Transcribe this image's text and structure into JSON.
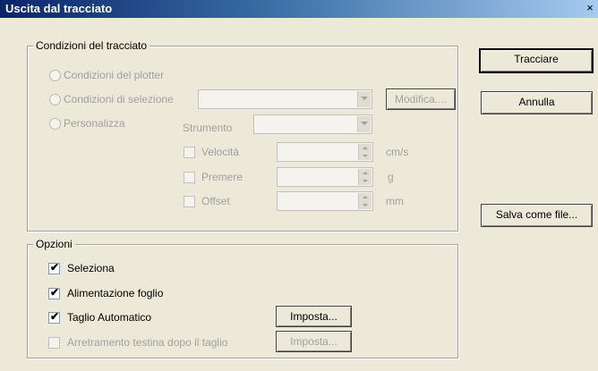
{
  "window": {
    "title": "Uscita dal tracciato",
    "close_glyph": "×"
  },
  "conditions": {
    "legend": "Condizioni del tracciato",
    "radio_plotter": "Condizioni del plotter",
    "radio_selection": "Condizioni di selezione",
    "radio_custom": "Personalizza",
    "modify_button": "Modifica....",
    "tool_label": "Strumento",
    "speed_label": "Velocità",
    "speed_unit": "cm/s",
    "pressure_label": "Premere",
    "pressure_unit": "g",
    "offset_label": "Offset",
    "offset_unit": "mm"
  },
  "options": {
    "legend": "Opzioni",
    "select_label": "Seleziona",
    "select_checked": true,
    "feed_label": "Alimentazione foglio",
    "feed_checked": true,
    "autocut_label": "Taglio Automatico",
    "autocut_checked": true,
    "autocut_setup_button": "Imposta...",
    "retract_label": "Arretramento testina dopo il taglio",
    "retract_checked": false,
    "retract_setup_button": "Imposta..."
  },
  "buttons": {
    "plot": "Tracciare",
    "cancel": "Annulla",
    "save_file": "Salva come file..."
  },
  "icons": {
    "check": "check-icon",
    "dropdown": "chevron-down-icon",
    "spin": "spin-arrows-icon"
  },
  "colors": {
    "face": "#ece9d8",
    "title_start": "#0a246a",
    "title_end": "#a6caf0",
    "disabled_text": "#a0a0a0"
  }
}
